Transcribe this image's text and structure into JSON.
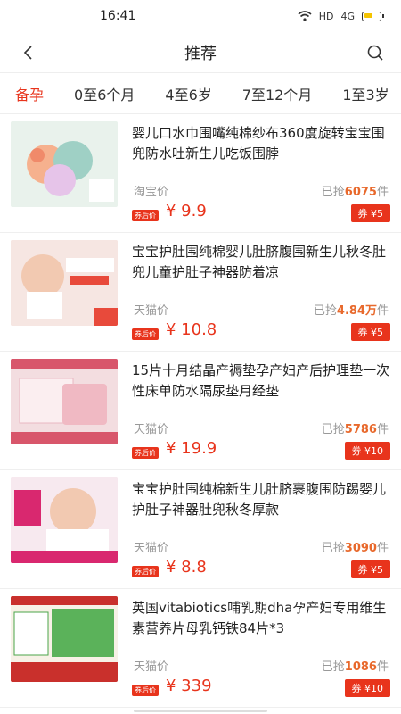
{
  "status": {
    "time": "16:41",
    "network": "HD",
    "signal": "4G"
  },
  "nav": {
    "title": "推荐"
  },
  "tabs": [
    "备孕",
    "0至6个月",
    "4至6岁",
    "7至12个月",
    "1至3岁"
  ],
  "items": [
    {
      "title": "婴儿口水巾围嘴纯棉纱布360度旋转宝宝围兜防水吐新生儿吃饭围脖",
      "platform": "淘宝价",
      "sold_prefix": "已抢",
      "sold": "6075",
      "sold_suffix": "件",
      "tag": "券后价",
      "price": "¥ 9.9",
      "coupon": "券 ¥5",
      "thumb_bg": "#e9f2ec",
      "thumb_accent": "#f08a6a"
    },
    {
      "title": "宝宝护肚围纯棉婴儿肚脐腹围新生儿秋冬肚兜儿童护肚子神器防着凉",
      "platform": "天猫价",
      "sold_prefix": "已抢",
      "sold": "4.84万",
      "sold_suffix": "件",
      "tag": "券后价",
      "price": "¥ 10.8",
      "coupon": "券 ¥5",
      "thumb_bg": "#f6e6e2",
      "thumb_accent": "#e84a3b"
    },
    {
      "title": "15片十月结晶产褥垫孕产妇产后护理垫一次性床单防水隔尿垫月经垫",
      "platform": "天猫价",
      "sold_prefix": "已抢",
      "sold": "5786",
      "sold_suffix": "件",
      "tag": "券后价",
      "price": "¥ 19.9",
      "coupon": "券 ¥10",
      "thumb_bg": "#f3dde0",
      "thumb_accent": "#d8566b"
    },
    {
      "title": "宝宝护肚围纯棉新生儿肚脐裹腹围防踢婴儿护肚子神器肚兜秋冬厚款",
      "platform": "天猫价",
      "sold_prefix": "已抢",
      "sold": "3090",
      "sold_suffix": "件",
      "tag": "券后价",
      "price": "¥ 8.8",
      "coupon": "券 ¥5",
      "thumb_bg": "#f7e9ef",
      "thumb_accent": "#d9286f"
    },
    {
      "title": "英国vitabiotics哺乳期dha孕产妇专用维生素营养片母乳钙铁84片*3",
      "platform": "天猫价",
      "sold_prefix": "已抢",
      "sold": "1086",
      "sold_suffix": "件",
      "tag": "券后价",
      "price": "¥ 339",
      "coupon": "券 ¥10",
      "thumb_bg": "#f7f1e6",
      "thumb_accent": "#4ba54a"
    }
  ],
  "colors": {
    "accent": "#e8341c",
    "sold_highlight": "#e8692c"
  }
}
